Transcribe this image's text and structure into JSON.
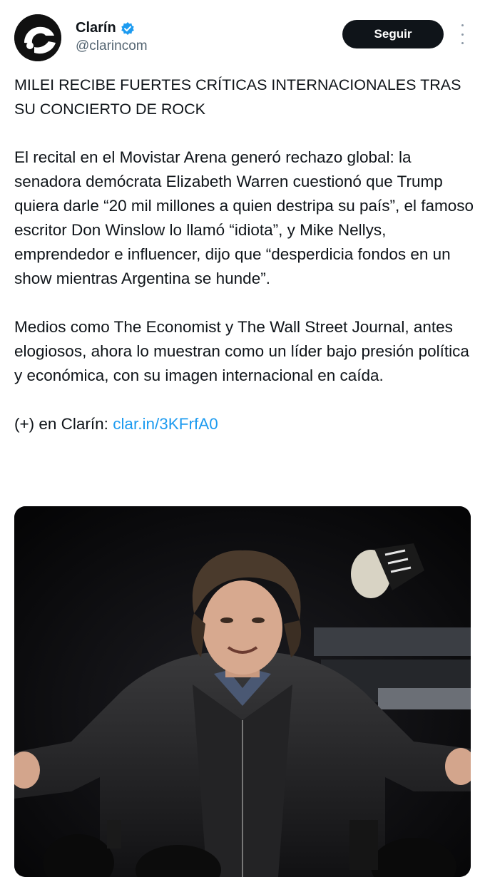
{
  "account": {
    "name": "Clarín",
    "handle": "@clarincom",
    "verified": true,
    "logo_icon": "clarin-logo"
  },
  "follow_button": {
    "label": "Seguir"
  },
  "more_icon": "more-vertical-icon",
  "tweet": {
    "headline": "MILEI RECIBE FUERTES CRÍTICAS INTERNACIONALES TRAS SU CONCIERTO DE ROCK",
    "paragraph1": "El recital en el Movistar Arena generó rechazo global: la senadora demócrata Elizabeth Warren cuestionó que Trump quiera darle “20 mil millones a quien destripa su país”, el famoso escritor Don Winslow lo llamó “idiota”, y Mike Nellys, emprendedor e influencer, dijo que “desperdicia fondos en un show mientras Argentina se hunde”.",
    "paragraph2": "Medios como The Economist y The Wall Street Journal, antes elogiosos, ahora lo muestran como un líder bajo presión política y económica, con su imagen internacional en caída.",
    "link_prefix": "(+) en Clarín: ",
    "link_text": "clar.in/3KFrfA0"
  },
  "colors": {
    "link": "#1d9bf0",
    "button_bg": "#0f1419",
    "handle": "#536471",
    "verified": "#1d9bf0"
  }
}
